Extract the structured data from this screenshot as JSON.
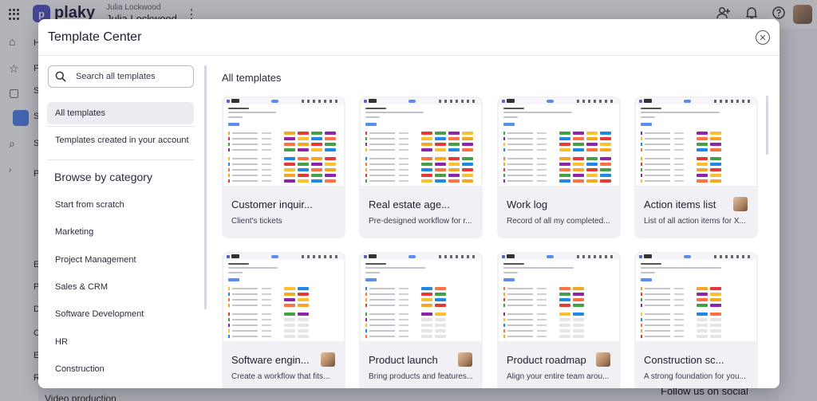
{
  "app": {
    "logo_letter": "p",
    "logo_text": "plaky",
    "user_sub": "Julia Lockwood",
    "user_name": "Julia Lockwood",
    "sidebar_letters": [
      "Ho",
      "Fa",
      "Sp",
      "S",
      "Se",
      "P",
      "E",
      "P",
      "D",
      "C",
      "E",
      "R"
    ],
    "bottom_left_text": "Video production",
    "bottom_right_text": "Follow us on social"
  },
  "modal": {
    "title": "Template Center",
    "close_icon": "close-circle-icon",
    "search_placeholder": "Search all templates",
    "nav": [
      "All templates",
      "Templates created in your account"
    ],
    "browse_heading": "Browse by category",
    "categories": [
      "Start from scratch",
      "Marketing",
      "Project Management",
      "Sales & CRM",
      "Software Development",
      "HR",
      "Construction"
    ],
    "section_title": "All templates",
    "cards": [
      {
        "name": "Customer inquir...",
        "desc": "Client's tickets",
        "has_author": false
      },
      {
        "name": "Real estate age...",
        "desc": "Pre-designed workflow for r...",
        "has_author": false
      },
      {
        "name": "Work log",
        "desc": "Record of all my completed...",
        "has_author": false
      },
      {
        "name": "Action items list",
        "desc": "List of all action items for X...",
        "has_author": true
      },
      {
        "name": "Software engin...",
        "desc": "Create a workflow that fits...",
        "has_author": true
      },
      {
        "name": "Product launch",
        "desc": "Bring products and features...",
        "has_author": true
      },
      {
        "name": "Product roadmap",
        "desc": "Align your entire team arou...",
        "has_author": true
      },
      {
        "name": "Construction sc...",
        "desc": "A strong foundation for you...",
        "has_author": false
      }
    ]
  },
  "colors": {
    "accent": "#5b5fc7",
    "status": [
      "#f5a623",
      "#e53935",
      "#43a047",
      "#8e24aa",
      "#fbc02d",
      "#1e88e5",
      "#ff7043"
    ]
  }
}
